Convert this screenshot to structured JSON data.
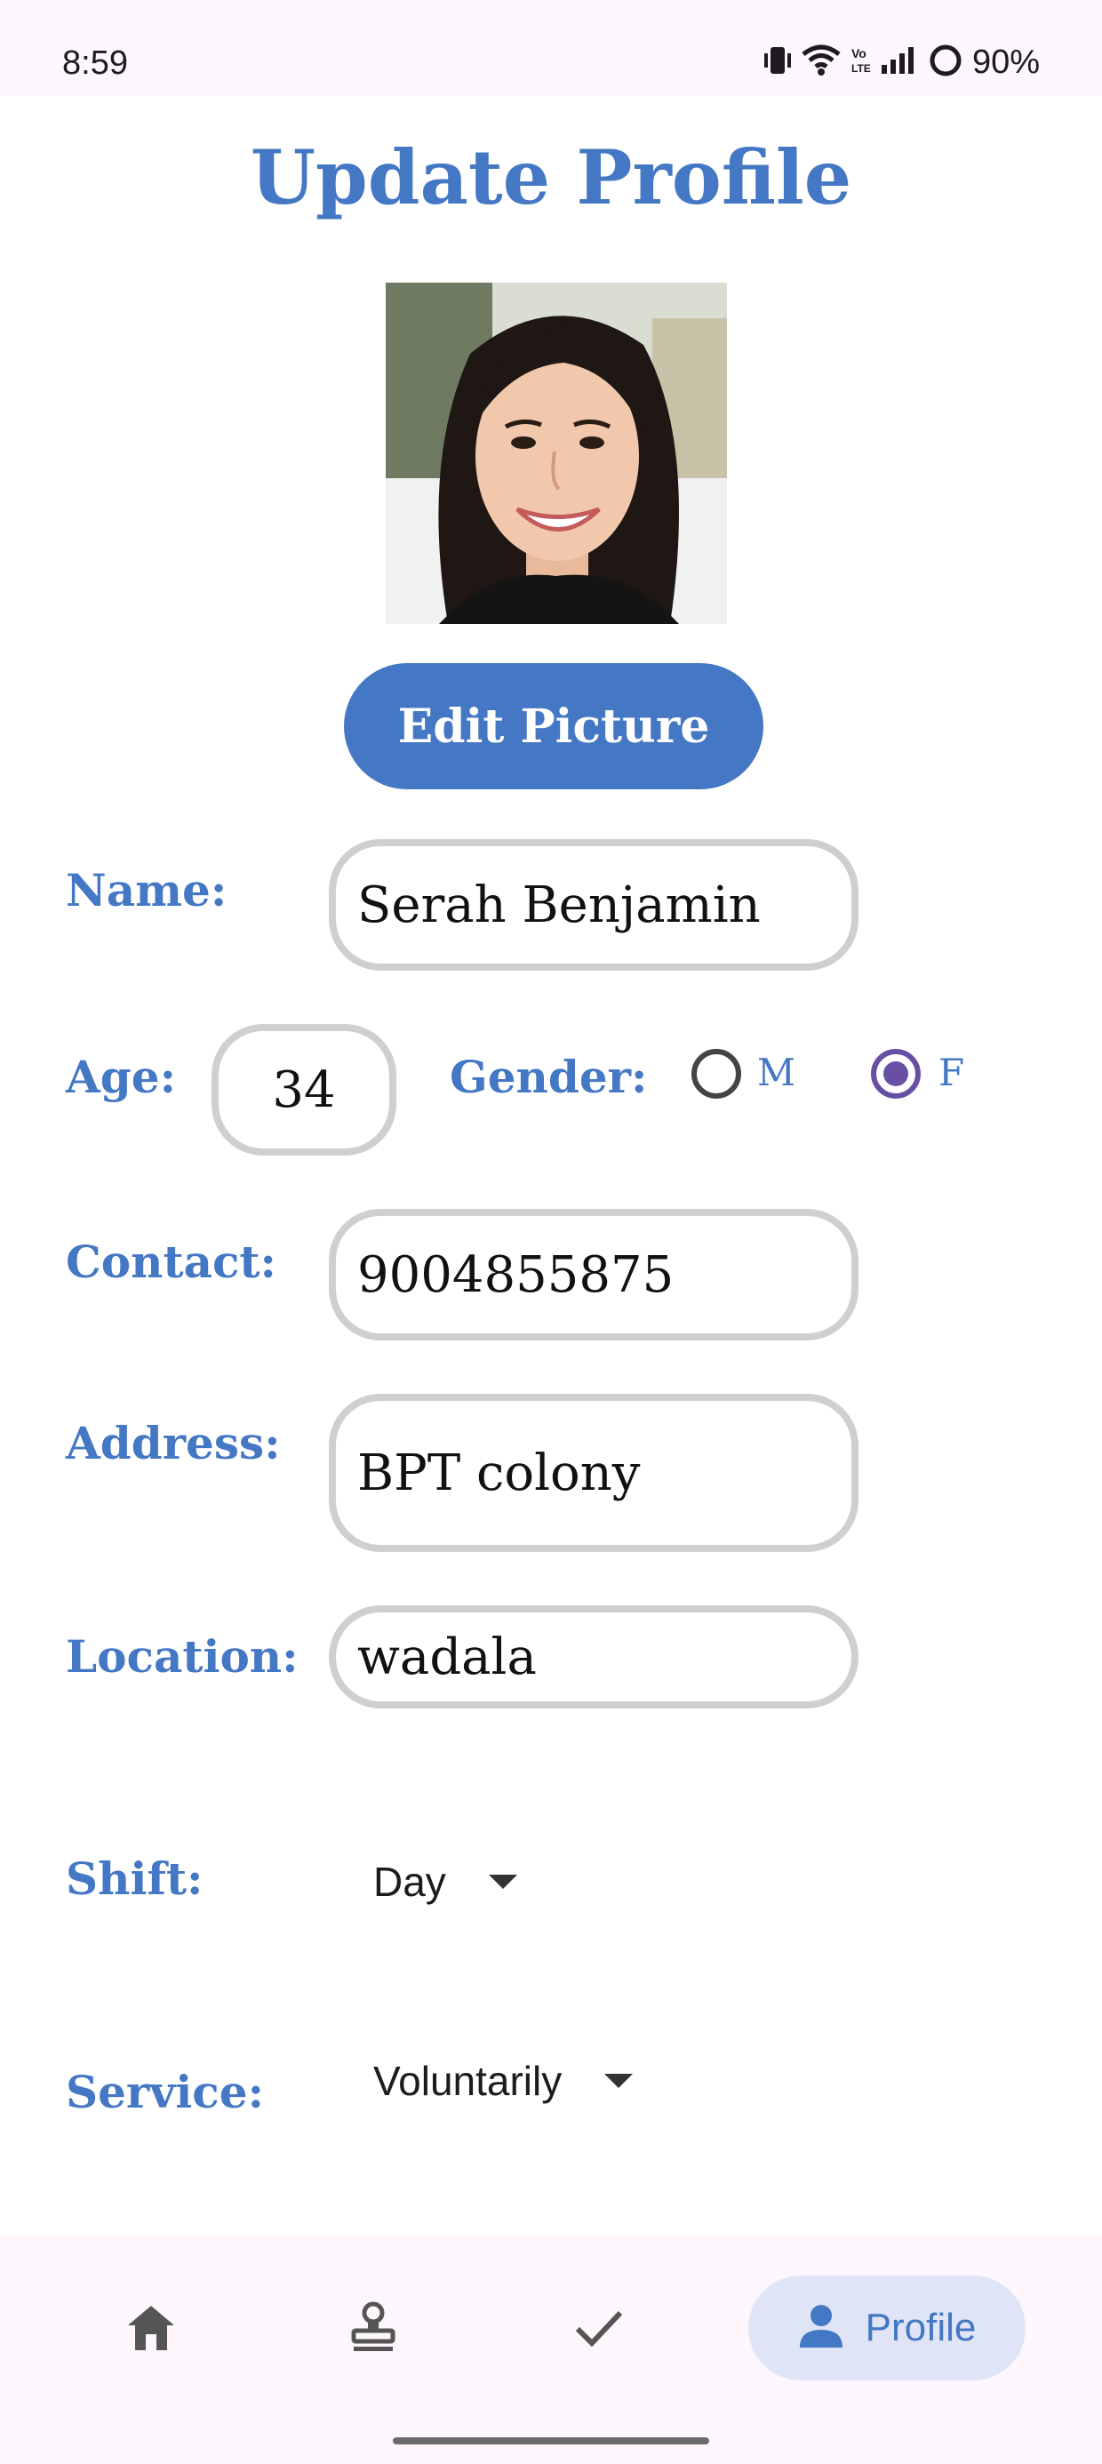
{
  "status_bar": {
    "time": "8:59",
    "battery": "90%",
    "icons": [
      "vibrate-icon",
      "wifi-icon",
      "volte-icon",
      "signal-icon",
      "battery-icon"
    ]
  },
  "title": "Update Profile",
  "avatar": {
    "description_icon": "profile-photo"
  },
  "edit_picture_label": "Edit Picture",
  "form": {
    "name": {
      "label": "Name:",
      "value": "Serah Benjamin"
    },
    "age": {
      "label": "Age:",
      "value": "34"
    },
    "gender": {
      "label": "Gender:",
      "options": [
        "M",
        "F"
      ],
      "selected": "F"
    },
    "contact": {
      "label": "Contact:",
      "value": "9004855875"
    },
    "address": {
      "label": "Address:",
      "value": "BPT colony"
    },
    "location": {
      "label": "Location:",
      "value": "wadala"
    },
    "shift": {
      "label": "Shift:",
      "value": "Day"
    },
    "service": {
      "label": "Service:",
      "value": "Voluntarily"
    }
  },
  "bottom_nav": {
    "items": [
      {
        "icon": "home-icon"
      },
      {
        "icon": "stamp-icon"
      },
      {
        "icon": "check-icon"
      },
      {
        "icon": "person-icon",
        "label": "Profile",
        "active": true
      }
    ]
  },
  "colors": {
    "accent": "#4477c4",
    "radio_selected": "#6750a4",
    "field_border": "#cfcfcf",
    "nav_background": "#fdf6fc",
    "nav_active_pill": "#dfe5f6"
  }
}
